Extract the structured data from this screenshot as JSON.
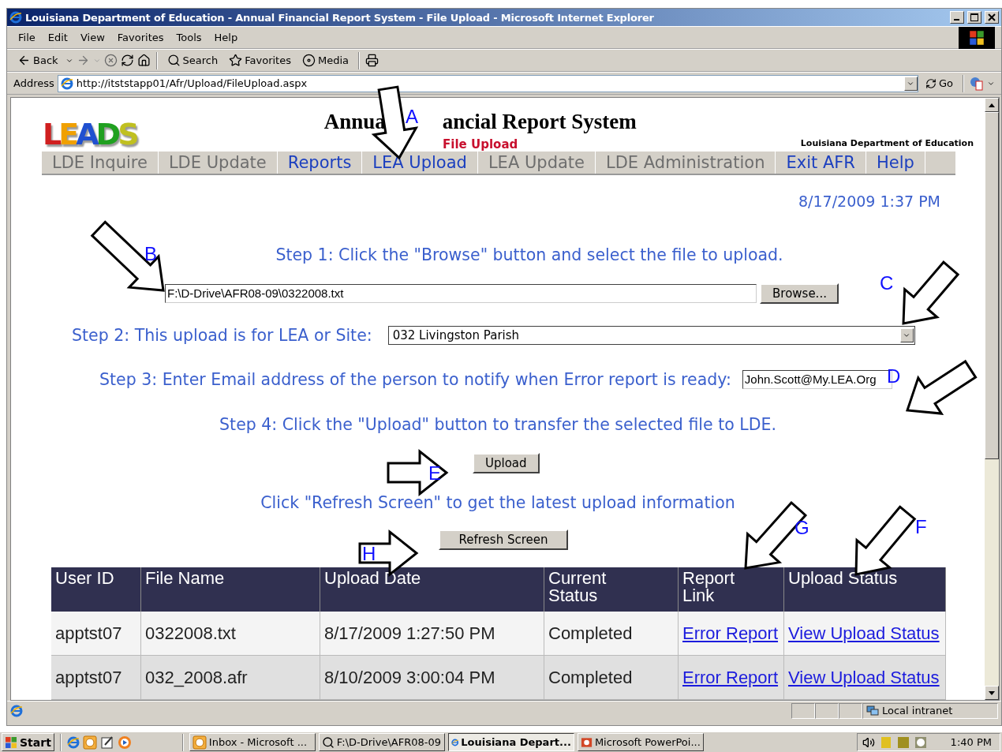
{
  "window": {
    "title": "Louisiana Department of Education - Annual Financial Report System - File Upload - Microsoft Internet Explorer"
  },
  "menu": [
    "File",
    "Edit",
    "View",
    "Favorites",
    "Tools",
    "Help"
  ],
  "toolbar": [
    {
      "kind": "back",
      "label": "Back"
    },
    {
      "kind": "forward"
    },
    {
      "kind": "stop"
    },
    {
      "kind": "refresh"
    },
    {
      "kind": "home"
    },
    {
      "kind": "search",
      "label": "Search"
    },
    {
      "kind": "favorites",
      "label": "Favorites"
    },
    {
      "kind": "media",
      "label": "Media"
    },
    {
      "kind": "print"
    }
  ],
  "address": {
    "label": "Address",
    "url": "http://itststapp01/Afr/Upload/FileUpload.aspx",
    "go": "Go"
  },
  "header": {
    "logo": "LEADS",
    "title_parts": [
      "Annua",
      "ancial Report System"
    ],
    "subtitle": "File Upload",
    "org": "Louisiana Department of Education"
  },
  "nav": [
    {
      "label": "LDE Inquire",
      "disabled": true
    },
    {
      "label": "LDE Update",
      "disabled": true
    },
    {
      "label": "Reports",
      "disabled": false
    },
    {
      "label": "LEA Upload",
      "disabled": false
    },
    {
      "label": "LEA Update",
      "disabled": true
    },
    {
      "label": "LDE Administration",
      "disabled": true
    },
    {
      "label": "Exit AFR",
      "disabled": false
    },
    {
      "label": "Help",
      "disabled": false
    }
  ],
  "datetime": "8/17/2009 1:37 PM",
  "step1": {
    "text": "Step 1: Click the \"Browse\" button and select the file to upload.",
    "file": "F:\\D-Drive\\AFR08-09\\0322008.txt",
    "button": "Browse..."
  },
  "step2": {
    "label": "Step 2:  This upload is for LEA or Site:",
    "value": "032 Livingston Parish"
  },
  "step3": {
    "label": "Step 3: Enter Email address of the person to notify when Error report is ready:",
    "value": "John.Scott@My.LEA.Org"
  },
  "step4": {
    "text": "Step 4: Click the \"Upload\" button to transfer the selected file to LDE.",
    "button": "Upload"
  },
  "refresh": {
    "text": "Click \"Refresh Screen\" to get the latest upload information",
    "button": "Refresh Screen"
  },
  "table": {
    "columns": [
      "User ID",
      "File Name",
      "Upload Date",
      "Current Status",
      "Report Link",
      "Upload Status"
    ],
    "rows": [
      {
        "user": "apptst07",
        "file": "0322008.txt",
        "date": "8/17/2009 1:27:50 PM",
        "status": "Completed",
        "report": "Error Report",
        "upload_status": "View Upload Status"
      },
      {
        "user": "apptst07",
        "file": "032_2008.afr",
        "date": "8/10/2009 3:00:04 PM",
        "status": "Completed",
        "report": "Error Report",
        "upload_status": "View Upload Status"
      }
    ]
  },
  "annotations": [
    {
      "label": "A"
    },
    {
      "label": "B"
    },
    {
      "label": "C"
    },
    {
      "label": "D"
    },
    {
      "label": "E"
    },
    {
      "label": "H"
    },
    {
      "label": "G"
    },
    {
      "label": "F"
    }
  ],
  "status_bar": {
    "zone": "Local intranet"
  },
  "taskbar": {
    "start": "Start",
    "tasks": [
      {
        "label": "Inbox - Microsoft ...",
        "kind": "outlook",
        "selected": false
      },
      {
        "label": "F:\\D-Drive\\AFR08-09",
        "kind": "folder",
        "selected": false
      },
      {
        "label": "Louisiana Depart...",
        "kind": "ie",
        "selected": true
      },
      {
        "label": "Microsoft PowerPoi...",
        "kind": "powerpoint",
        "selected": false
      }
    ],
    "clock": "1:40 PM"
  }
}
